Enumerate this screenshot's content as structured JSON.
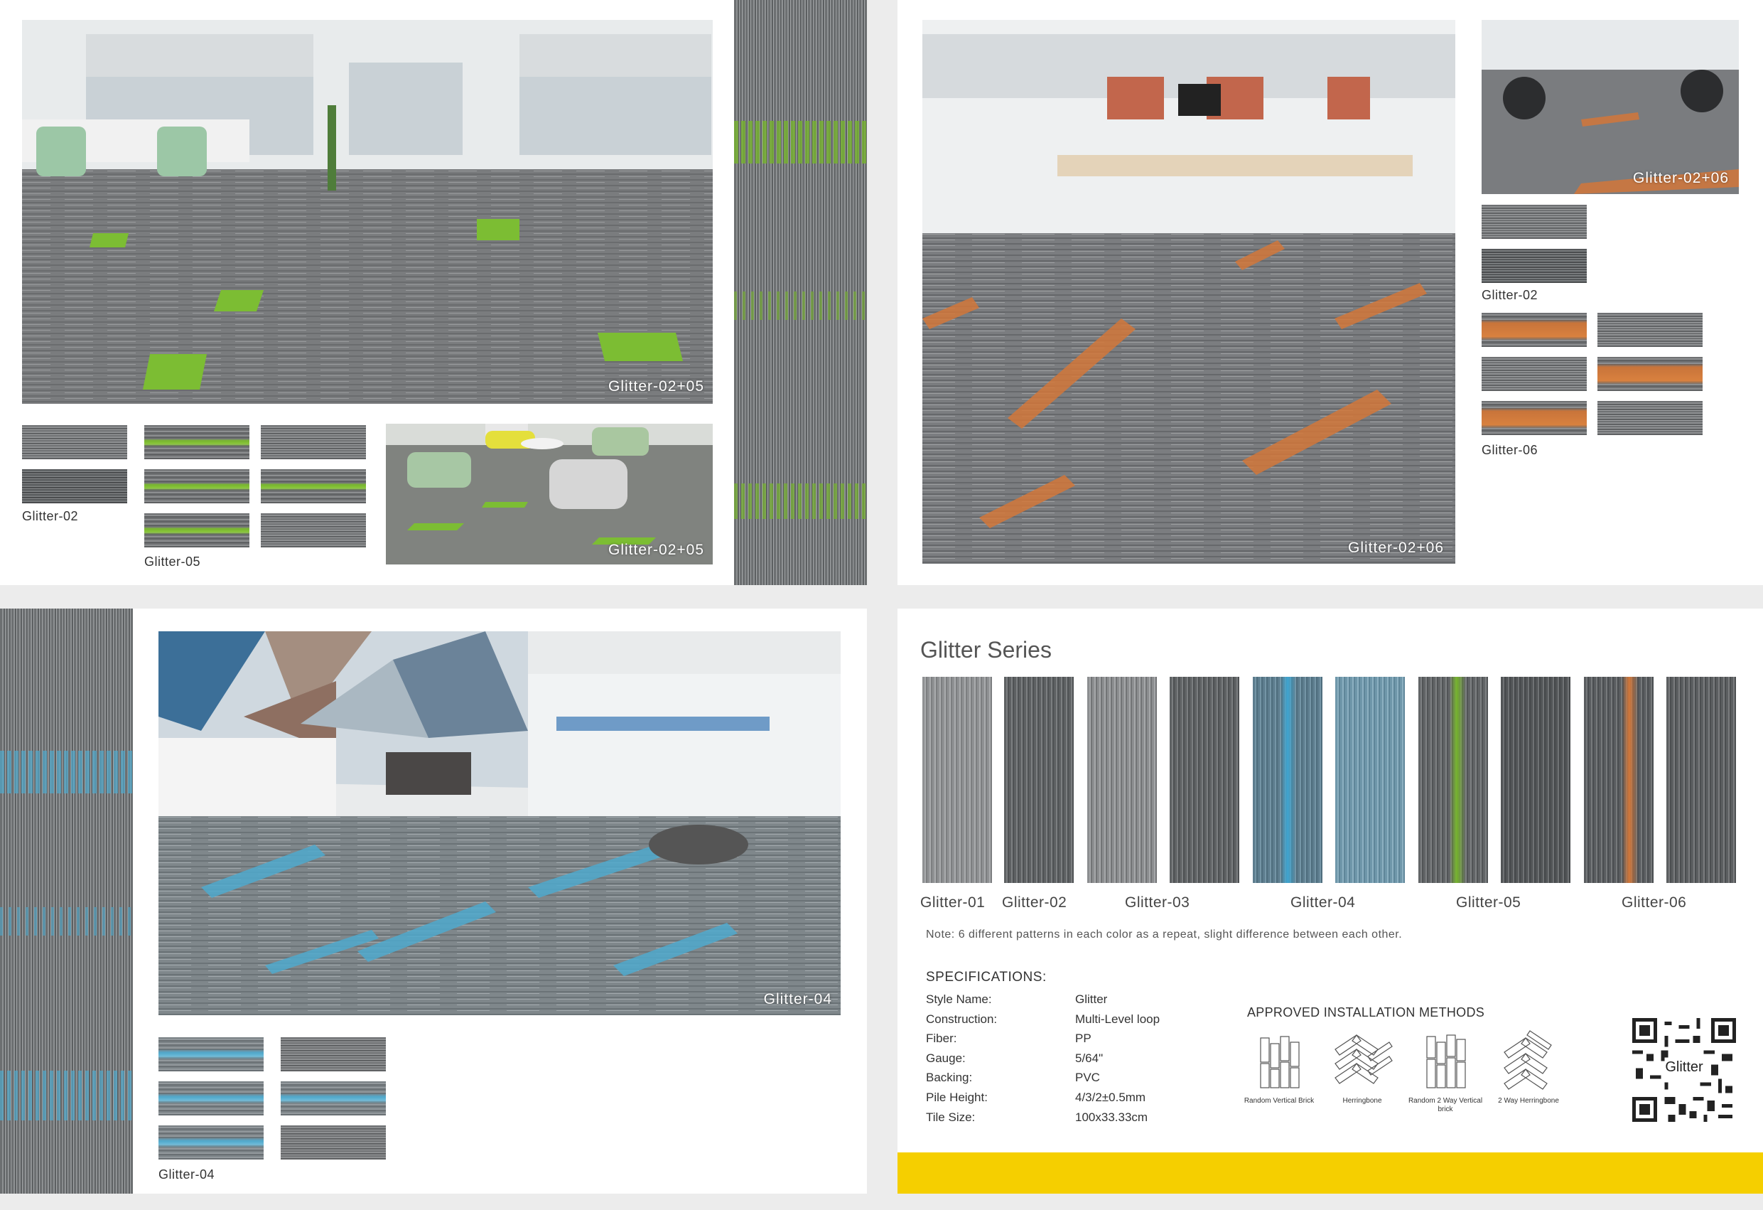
{
  "panels": {
    "top_left": {
      "main_caption": "Glitter-02+05",
      "side_caption": "Glitter-02+05",
      "label_a": "Glitter-02",
      "label_b": "Glitter-05"
    },
    "top_right": {
      "main_caption": "Glitter-02+06",
      "thumb_caption": "Glitter-02+06",
      "label_a": "Glitter-02",
      "label_b": "Glitter-06"
    },
    "bottom_left": {
      "main_caption": "Glitter-04",
      "label_a": "Glitter-04"
    },
    "bottom_right": {
      "title": "Glitter Series",
      "columns": [
        "Glitter-01",
        "Glitter-02",
        "Glitter-03",
        "Glitter-04",
        "Glitter-05",
        "Glitter-06"
      ],
      "note": "Note: 6 different patterns in each color as a repeat, slight difference between each other.",
      "spec_heading": "SPECIFICATIONS:",
      "specs": [
        {
          "k": "Style Name:",
          "v": "Glitter"
        },
        {
          "k": "Construction:",
          "v": "Multi-Level loop"
        },
        {
          "k": "Fiber:",
          "v": "PP"
        },
        {
          "k": "Gauge:",
          "v": "5/64\""
        },
        {
          "k": "Backing:",
          "v": "PVC"
        },
        {
          "k": "Pile Height:",
          "v": "4/3/2±0.5mm"
        },
        {
          "k": "Tile Size:",
          "v": "100x33.33cm"
        }
      ],
      "install_heading": "APPROVED INSTALLATION METHODS",
      "install": [
        "Random Vertical Brick",
        "Herringbone",
        "Random 2 Way Vertical brick",
        "2 Way Herringbone"
      ],
      "qr_label": "Glitter"
    }
  },
  "colors": {
    "accent_yellow": "#f5cf00",
    "green": "#7cbd33",
    "orange": "#d2773a",
    "blue": "#4fa9cc"
  }
}
